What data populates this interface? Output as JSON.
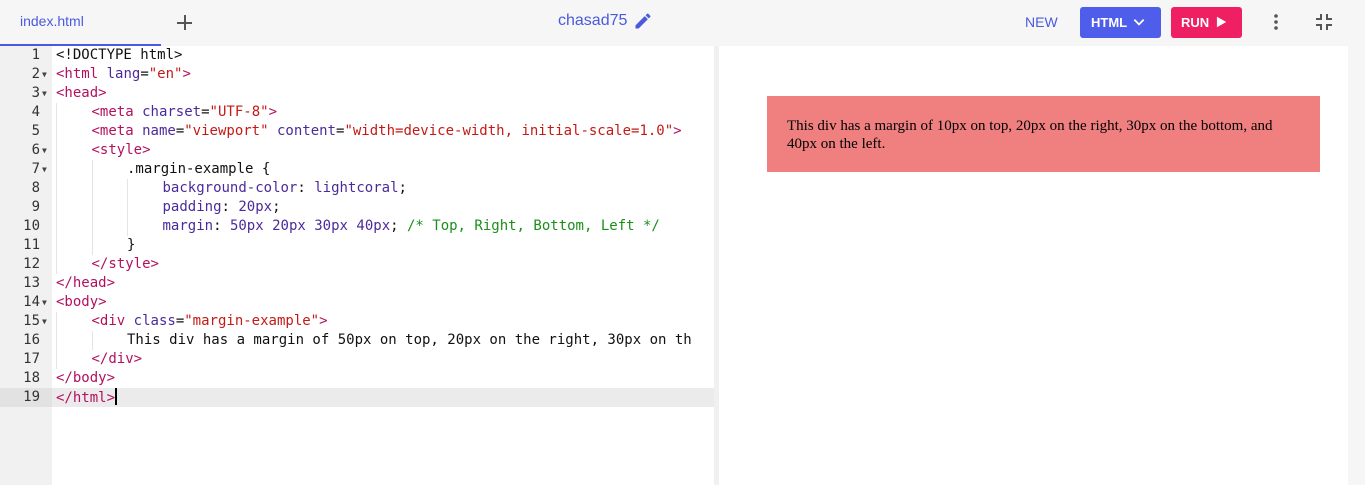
{
  "tab": {
    "label": "index.html"
  },
  "header": {
    "title": "chasad75",
    "new_label": "NEW",
    "lang_label": "HTML",
    "run_label": "RUN"
  },
  "editor": {
    "lines": [
      {
        "n": "1",
        "fold": false,
        "indent": 0,
        "html": "&lt;!DOCTYPE html&gt;"
      },
      {
        "n": "2",
        "fold": true,
        "indent": 0,
        "html": "<span class='tag'>&lt;html</span> <span class='attr'>lang</span>=<span class='str'>\"en\"</span><span class='tag'>&gt;</span>"
      },
      {
        "n": "3",
        "fold": true,
        "indent": 0,
        "html": "<span class='tag'>&lt;head&gt;</span>"
      },
      {
        "n": "4",
        "fold": false,
        "indent": 1,
        "html": "<span class='tag'>&lt;meta</span> <span class='attr'>charset</span>=<span class='str'>\"UTF-8\"</span><span class='tag'>&gt;</span>"
      },
      {
        "n": "5",
        "fold": false,
        "indent": 1,
        "html": "<span class='tag'>&lt;meta</span> <span class='attr'>name</span>=<span class='str'>\"viewport\"</span> <span class='attr'>content</span>=<span class='str'>\"width=device-width, initial-scale=1.0\"</span><span class='tag'>&gt;</span>"
      },
      {
        "n": "6",
        "fold": true,
        "indent": 1,
        "html": "<span class='tag'>&lt;style&gt;</span>"
      },
      {
        "n": "7",
        "fold": true,
        "indent": 2,
        "html": ".margin-example {"
      },
      {
        "n": "8",
        "fold": false,
        "indent": 3,
        "html": "<span class='prop'>background-color</span>: <span class='prop'>lightcoral</span>;"
      },
      {
        "n": "9",
        "fold": false,
        "indent": 3,
        "html": "<span class='prop'>padding</span>: <span class='num'>20px</span>;"
      },
      {
        "n": "10",
        "fold": false,
        "indent": 3,
        "html": "<span class='prop'>margin</span>: <span class='num'>50px</span> <span class='num'>20px</span> <span class='num'>30px</span> <span class='num'>40px</span>; <span class='cmt'>/* Top, Right, Bottom, Left */</span>"
      },
      {
        "n": "11",
        "fold": false,
        "indent": 2,
        "html": "}"
      },
      {
        "n": "12",
        "fold": false,
        "indent": 1,
        "html": "<span class='tag'>&lt;/style&gt;</span>"
      },
      {
        "n": "13",
        "fold": false,
        "indent": 0,
        "html": "<span class='tag'>&lt;/head&gt;</span>"
      },
      {
        "n": "14",
        "fold": true,
        "indent": 0,
        "html": "<span class='tag'>&lt;body&gt;</span>"
      },
      {
        "n": "15",
        "fold": true,
        "indent": 1,
        "html": "<span class='tag'>&lt;div</span> <span class='attr'>class</span>=<span class='str'>\"margin-example\"</span><span class='tag'>&gt;</span>"
      },
      {
        "n": "16",
        "fold": false,
        "indent": 2,
        "html": "This div has a margin of 50px on top, 20px on the right, 30px on th"
      },
      {
        "n": "17",
        "fold": false,
        "indent": 1,
        "html": "<span class='tag'>&lt;/div&gt;</span>"
      },
      {
        "n": "18",
        "fold": false,
        "indent": 0,
        "html": "<span class='tag'>&lt;/body&gt;</span>"
      },
      {
        "n": "19",
        "fold": false,
        "indent": 0,
        "html": "<span class='tag'>&lt;/html&gt;</span><span class='cursor'></span>"
      }
    ]
  },
  "preview": {
    "text": "This div has a margin of 10px on top, 20px on the right, 30px on the bottom, and 40px on the left."
  },
  "colors": {
    "accent": "#4f5eea",
    "run": "#ee1f63",
    "box": "lightcoral"
  },
  "icons": [
    "plus-icon",
    "pencil-icon",
    "chevron-down-icon",
    "play-icon",
    "more-vert-icon",
    "fullscreen-exit-icon"
  ]
}
